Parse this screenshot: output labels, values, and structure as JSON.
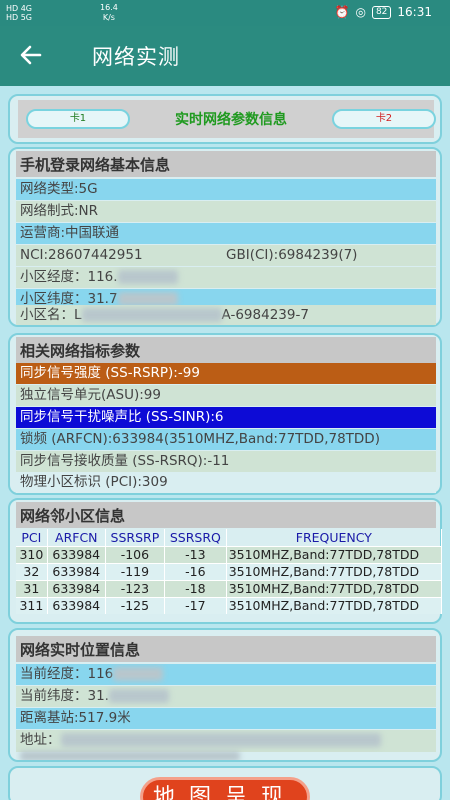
{
  "status_bar": {
    "sim_info_1": "HD 4G",
    "sim_info_2": "HD 5G",
    "net_speed_value": "16.4",
    "net_speed_unit": "K/s",
    "battery": "82",
    "time": "16:31"
  },
  "app_bar": {
    "back_icon": "arrow-left-icon",
    "title": "网络实测"
  },
  "sim_tabs": {
    "sim1_label": "卡1",
    "title": "实时网络参数信息",
    "sim2_label": "卡2"
  },
  "basic_info": {
    "header": "手机登录网络基本信息",
    "network_type": "网络类型:5G",
    "network_standard": "网络制式:NR",
    "operator": "运营商:中国联通",
    "nci": "NCI:28607442951",
    "gbi": "GBI(CI):6984239(7)",
    "cell_longitude": "小区经度：116.",
    "cell_latitude": "小区纬度：31.7",
    "cell_name_prefix": "小区名：L",
    "cell_name_suffix": "A-6984239-7"
  },
  "metrics": {
    "header": "相关网络指标参数",
    "ss_rsrp": "同步信号强度 (SS-RSRP):-99",
    "asu": "独立信号单元(ASU):99",
    "ss_sinr": "同步信号干扰噪声比 (SS-SINR):6",
    "arfcn": "锁频 (ARFCN):633984(3510MHZ,Band:77TDD,78TDD)",
    "ss_rsrq": "同步信号接收质量 (SS-RSRQ):-11",
    "pci": "物理小区标识 (PCI):309"
  },
  "neighbors": {
    "header": "网络邻小区信息",
    "columns": [
      "PCI",
      "ARFCN",
      "SSRSRP",
      "SSRSRQ",
      "FREQUENCY"
    ],
    "rows": [
      [
        "310",
        "633984",
        "-106",
        "-13",
        "3510MHZ,Band:77TDD,78TDD"
      ],
      [
        "32",
        "633984",
        "-119",
        "-16",
        "3510MHZ,Band:77TDD,78TDD"
      ],
      [
        "31",
        "633984",
        "-123",
        "-18",
        "3510MHZ,Band:77TDD,78TDD"
      ],
      [
        "311",
        "633984",
        "-125",
        "-17",
        "3510MHZ,Band:77TDD,78TDD"
      ]
    ]
  },
  "location": {
    "header": "网络实时位置信息",
    "longitude": "当前经度：116",
    "latitude": "当前纬度：31.",
    "distance": "距离基站:517.9米",
    "address": "地址："
  },
  "map_button": "地图呈现"
}
